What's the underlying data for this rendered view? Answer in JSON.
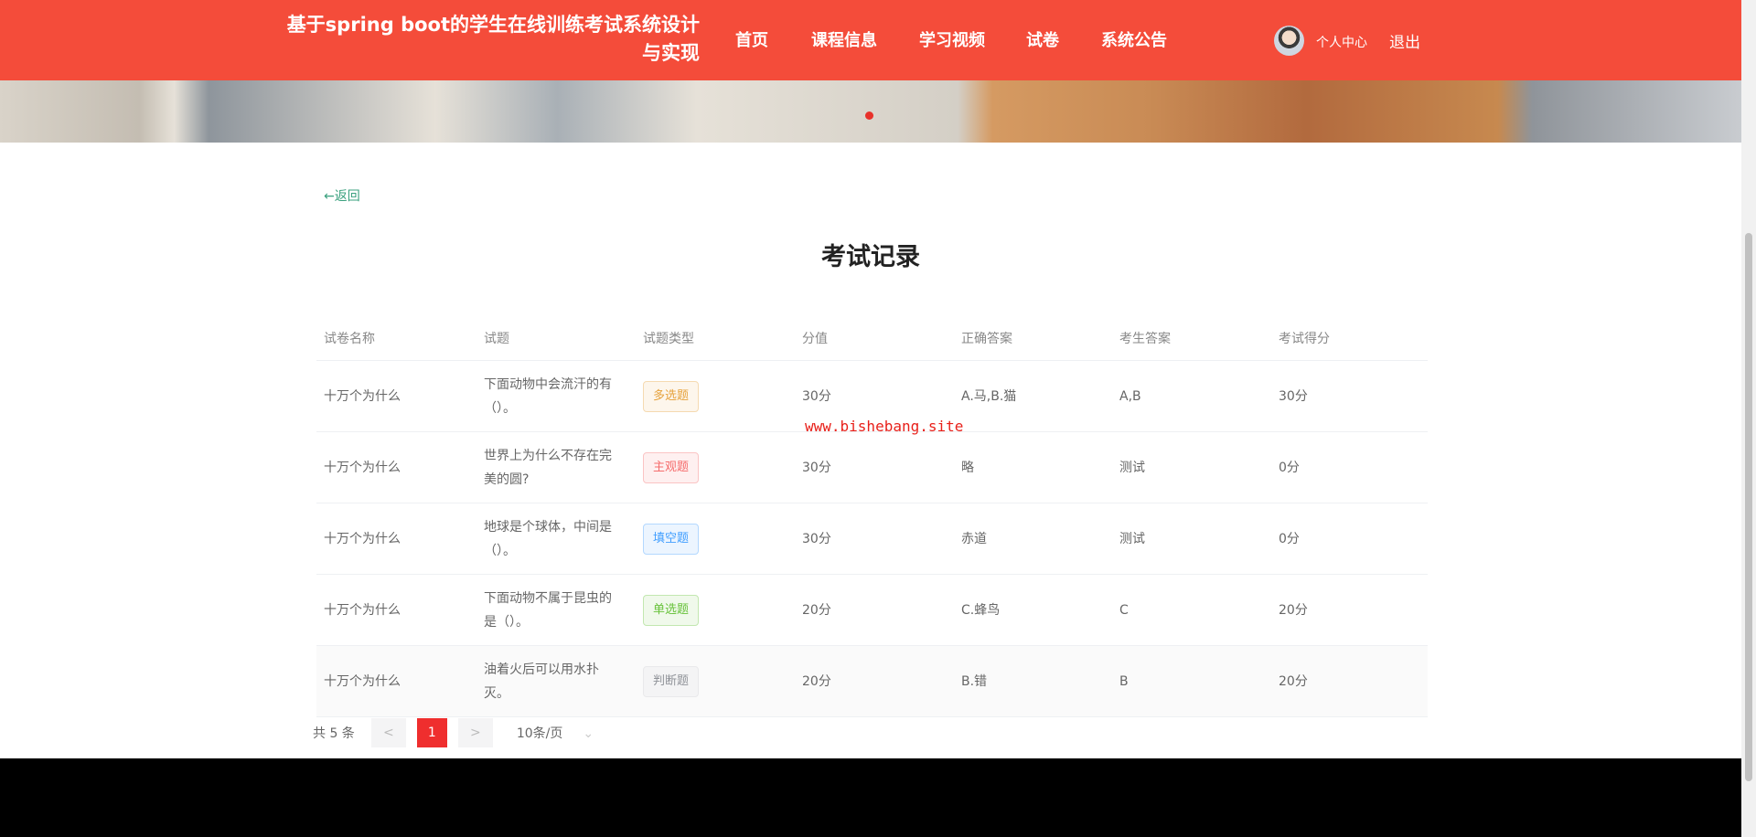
{
  "header": {
    "site_title": "基于spring boot的学生在线训练考试系统设计与实现",
    "nav": [
      "首页",
      "课程信息",
      "学习视频",
      "试卷",
      "系统公告"
    ],
    "user_center": "个人中心",
    "logout": "退出"
  },
  "back_label": "←返回",
  "page_title": "考试记录",
  "watermark": "www.bishebang.site",
  "table": {
    "columns": [
      "试卷名称",
      "试题",
      "试题类型",
      "分值",
      "正确答案",
      "考生答案",
      "考试得分"
    ],
    "rows": [
      {
        "paper": "十万个为什么",
        "question": "下面动物中会流汗的有（）。",
        "type": "多选题",
        "score": "30分",
        "correct": "A.马,B.猫",
        "answer": "A,B",
        "got": "30分"
      },
      {
        "paper": "十万个为什么",
        "question": "世界上为什么不存在完美的圆?",
        "type": "主观题",
        "score": "30分",
        "correct": "略",
        "answer": "测试",
        "got": "0分"
      },
      {
        "paper": "十万个为什么",
        "question": "地球是个球体，中间是（）。",
        "type": "填空题",
        "score": "30分",
        "correct": "赤道",
        "answer": "测试",
        "got": "0分"
      },
      {
        "paper": "十万个为什么",
        "question": "下面动物不属于昆虫的是（）。",
        "type": "单选题",
        "score": "20分",
        "correct": "C.蜂鸟",
        "answer": "C",
        "got": "20分"
      },
      {
        "paper": "十万个为什么",
        "question": "油着火后可以用水扑灭。",
        "type": "判断题",
        "score": "20分",
        "correct": "B.错",
        "answer": "B",
        "got": "20分"
      }
    ]
  },
  "tag_colors": {
    "多选题": [
      "#fdf6ec",
      "#f5dab1",
      "#e6a23c"
    ],
    "主观题": [
      "#fef0f0",
      "#fbc4c4",
      "#f56c6c"
    ],
    "填空题": [
      "#ecf5ff",
      "#b3d8ff",
      "#409eff"
    ],
    "单选题": [
      "#f0f9eb",
      "#c2e7b0",
      "#67c23a"
    ],
    "判断题": [
      "#f4f4f5",
      "#e9e9eb",
      "#909399"
    ]
  },
  "pagination": {
    "total": "共 5 条",
    "prev": "<",
    "current": "1",
    "next": ">",
    "page_size": "10条/页"
  }
}
